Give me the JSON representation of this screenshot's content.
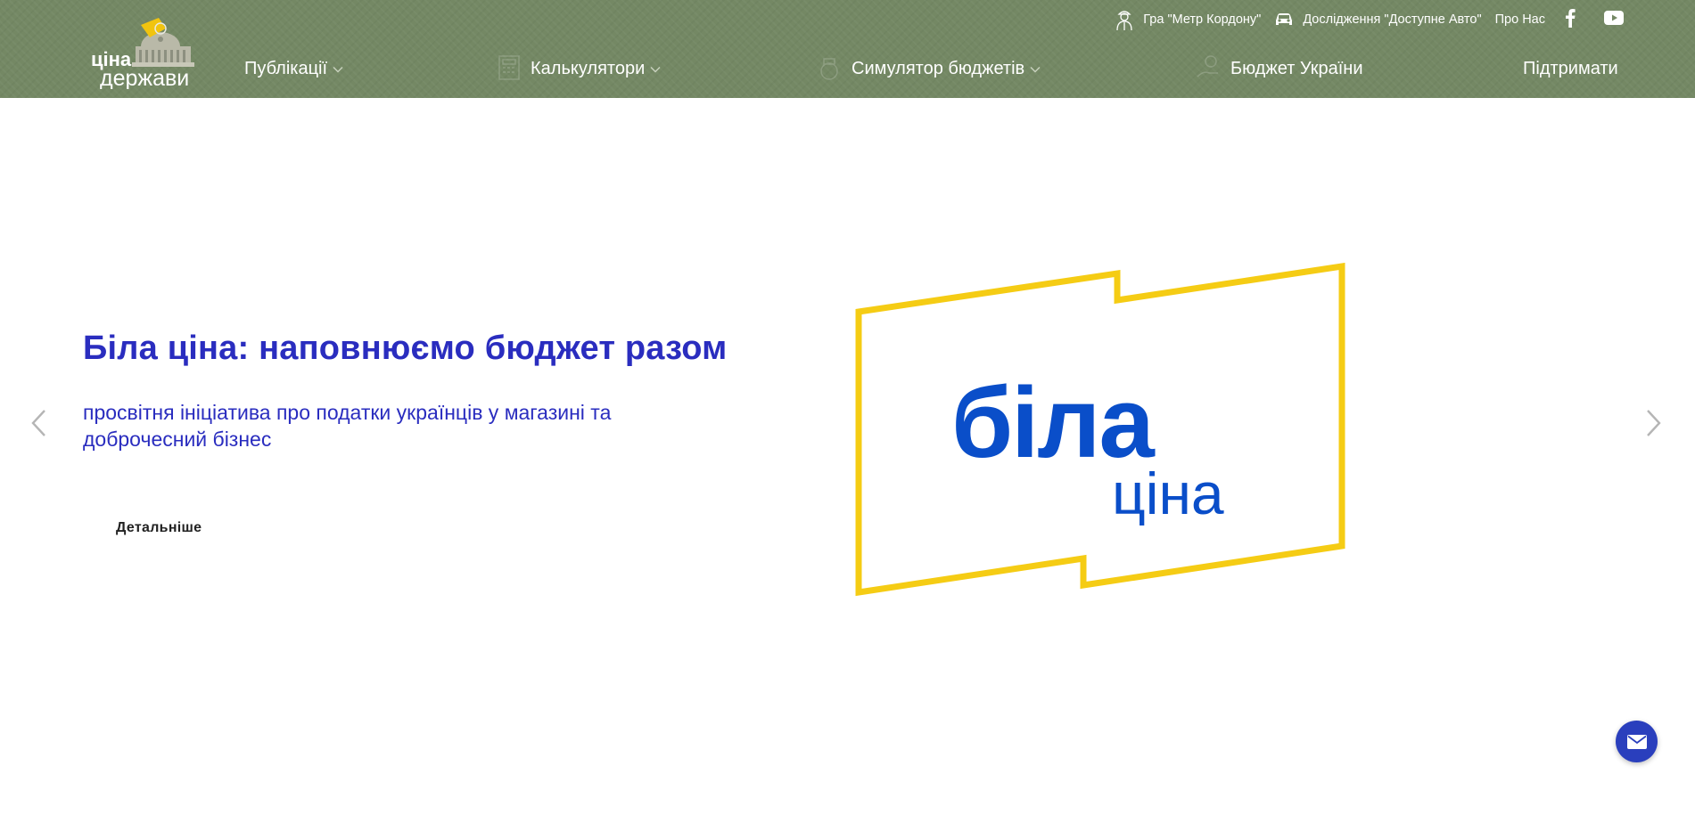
{
  "logo": {
    "line1": "ціна",
    "line2": "держави"
  },
  "topbar": {
    "game_link": "Гра \"Метр Кордону\"",
    "research_link": "Дослідження \"Доступне Авто\"",
    "about_link": "Про Нас",
    "social": [
      "facebook-icon",
      "youtube-icon"
    ]
  },
  "nav": {
    "publications": "Публікації",
    "calculators": "Калькулятори",
    "budget_simulator": "Симулятор бюджетів",
    "budget_ukraine": "Бюджет України",
    "support": "Підтримати"
  },
  "hero": {
    "title": "Біла ціна: наповнюємо бюджет разом",
    "subtitle": "просвітня ініціатива про податки українців у магазині та доброчесний бізнес",
    "button": "Детальніше",
    "graphic_word1": "біла",
    "graphic_word2": "ціна"
  },
  "colors": {
    "header_bg": "#748864",
    "accent_blue": "#2a2dbf",
    "brand_blue": "#0a4ec9",
    "brand_yellow": "#f5cc14",
    "fab_bg": "#2a3fbd"
  }
}
